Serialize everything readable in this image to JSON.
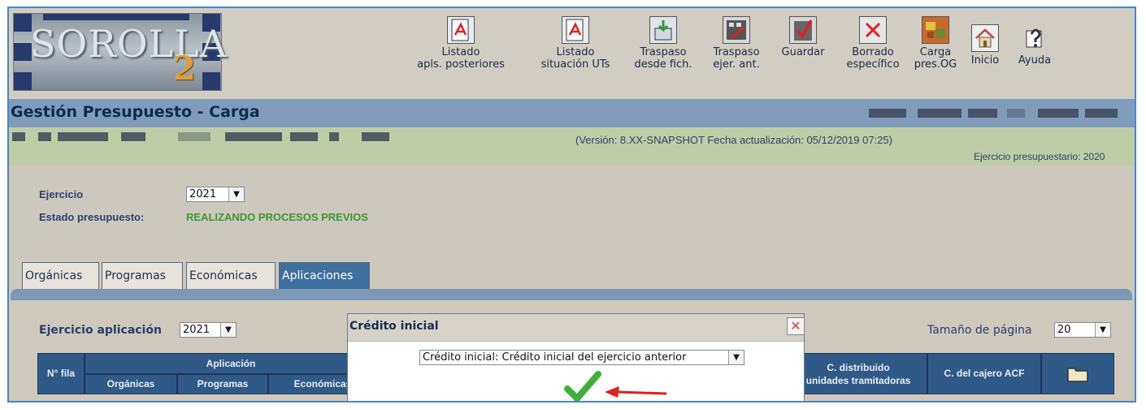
{
  "logo": {
    "word": "SOROLLA",
    "number": "2"
  },
  "toolbar": [
    {
      "name": "listado-apls-posteriores",
      "line1": "Listado",
      "line2": "apls. posteriores"
    },
    {
      "name": "listado-situacion-uts",
      "line1": "Listado",
      "line2": "situación UTs"
    },
    {
      "name": "traspaso-desde-fich",
      "line1": "Traspaso",
      "line2": "desde fich."
    },
    {
      "name": "traspaso-ejer-ant",
      "line1": "Traspaso",
      "line2": "ejer. ant."
    },
    {
      "name": "guardar",
      "line1": "Guardar",
      "line2": ""
    },
    {
      "name": "borrado-especifico",
      "line1": "Borrado",
      "line2": "específico"
    },
    {
      "name": "carga-pres-og",
      "line1": "Carga",
      "line2": "pres.OG"
    },
    {
      "name": "inicio",
      "line1": "Inicio",
      "line2": ""
    },
    {
      "name": "ayuda",
      "line1": "Ayuda",
      "line2": ""
    }
  ],
  "title": "Gestión Presupuesto - Carga",
  "version": "(Versión: 8.XX-SNAPSHOT Fecha actualización: 05/12/2019 07:25)",
  "ejercicio_presupuestario": "Ejercicio presupuestario: 2020",
  "form": {
    "ejercicio_label": "Ejercicio",
    "ejercicio_value": "2021",
    "estado_label": "Estado presupuesto:",
    "estado_value": "REALIZANDO PROCESOS PREVIOS"
  },
  "tabs": [
    "Orgánicas",
    "Programas",
    "Económicas",
    "Aplicaciones"
  ],
  "panel": {
    "ejercicio_aplicacion_label": "Ejercicio aplicación",
    "ejercicio_aplicacion_value": "2021",
    "tamano_pagina_label": "Tamaño de página",
    "tamano_pagina_value": "20"
  },
  "table": {
    "nfila": "N° fila",
    "aplicacion": "Aplicación",
    "organicas": "Orgánicas",
    "programas": "Programas",
    "economicas": "Económicas",
    "c_distribuido_1": "C. distribuido",
    "c_distribuido_2": "unidades tramitadoras",
    "c_cajero": "C. del cajero ACF"
  },
  "dialog": {
    "title": "Crédito inicial",
    "select_value": "Crédito inicial: Crédito inicial del ejercicio anterior"
  },
  "colors": {
    "accent": "#2f5a88",
    "status_green": "#3c9a2c",
    "confirm_green": "#3fae3a",
    "arrow_red": "#e02020"
  }
}
